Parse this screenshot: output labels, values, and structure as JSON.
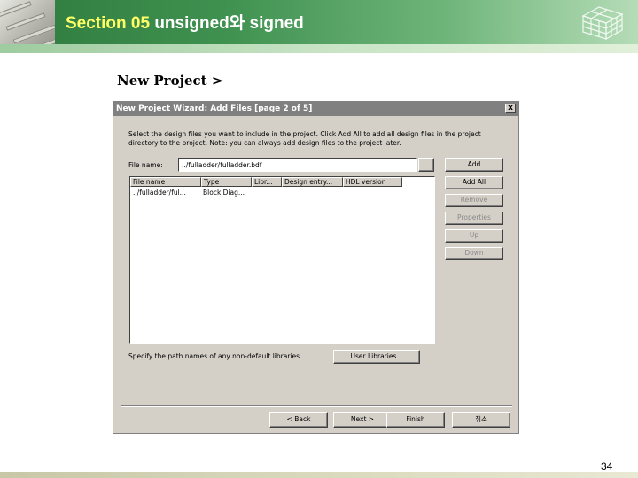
{
  "slide": {
    "section_label": "Section 05",
    "title_rest": " unsigned와 signed",
    "caption": "New Project  >",
    "page_number": "34"
  },
  "dialog": {
    "title": "New Project Wizard: Add Files [page 2 of 5]",
    "close_label": "x",
    "instructions": "Select the design files you want to include in the project. Click Add All to add all design files in the project directory to the project. Note: you can always add design files to the project later.",
    "file_name_label": "File name:",
    "file_name_value": "../fulladder/fulladder.bdf",
    "browse_label": "...",
    "side_buttons": {
      "add": "Add",
      "add_all": "Add All",
      "remove": "Remove",
      "properties": "Properties",
      "up": "Up",
      "down": "Down"
    },
    "table": {
      "columns": [
        "File name",
        "Type",
        "Libr...",
        "Design entry...",
        "HDL version"
      ],
      "rows": [
        [
          "../fulladder/ful...",
          "Block Diag..."
        ]
      ]
    },
    "library_hint": "Specify the path names of any non-default libraries.",
    "user_libraries_label": "User Libraries...",
    "nav_buttons": {
      "back": "< Back",
      "next": "Next >",
      "finish": "Finish",
      "cancel": "취소"
    }
  },
  "colors": {
    "header_green": "#3f9150",
    "section_yellow": "#ffff66",
    "dialog_gray": "#d4d0c8",
    "titlebar_gray": "#808080"
  }
}
